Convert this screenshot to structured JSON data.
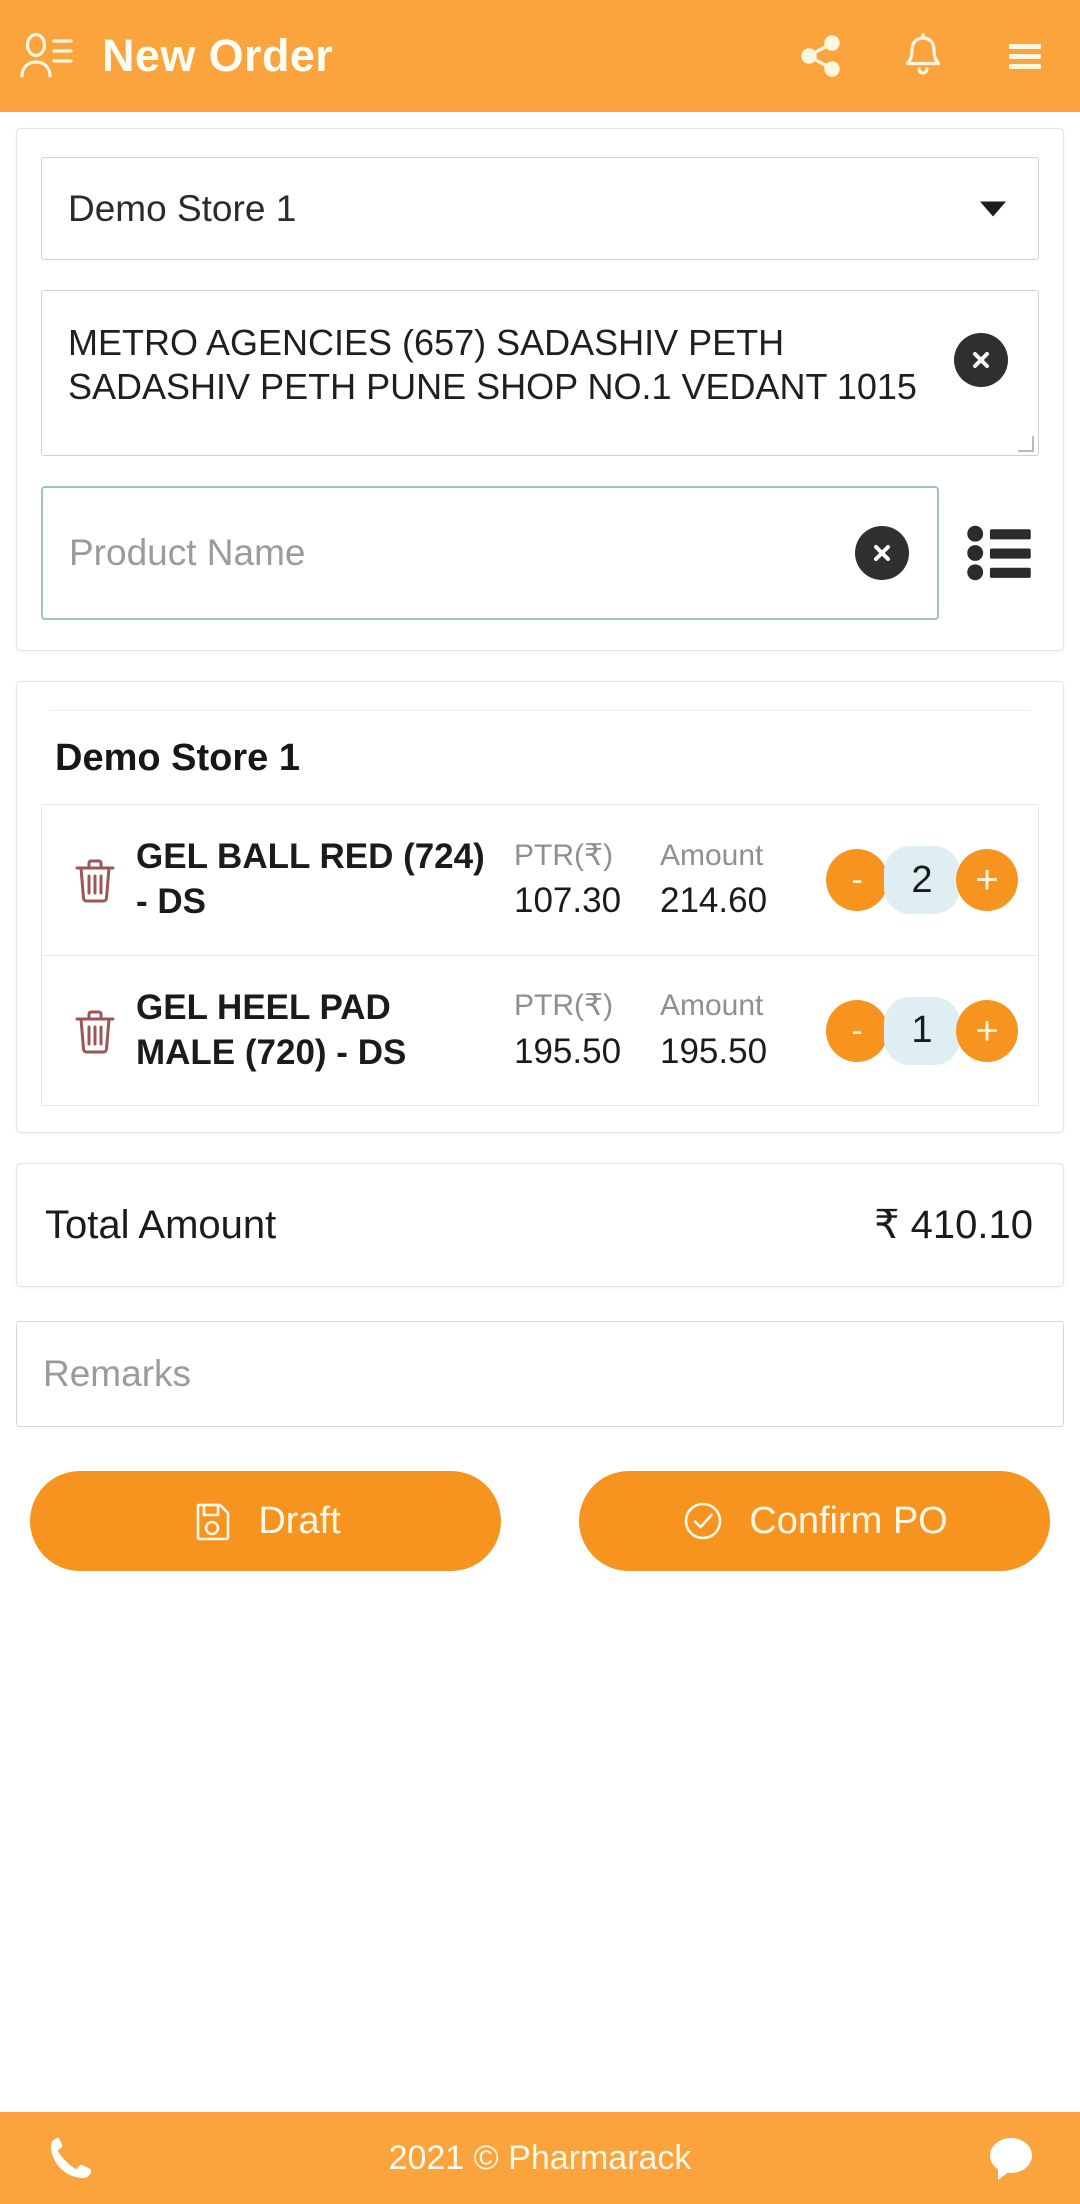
{
  "header": {
    "title": "New Order",
    "profile_icon": "user-list-icon",
    "actions": [
      {
        "icon": "share-icon",
        "name": "share-button"
      },
      {
        "icon": "bell-icon",
        "name": "notifications-button"
      },
      {
        "icon": "hamburger-menu-icon",
        "name": "menu-button"
      }
    ],
    "background": "#FBA33C"
  },
  "order_form": {
    "store_select": {
      "value": "Demo Store 1",
      "caret_icon": "chevron-down-icon"
    },
    "distributor": {
      "value": "METRO AGENCIES (657) SADASHIV PETH SADASHIV PETH PUNE SHOP NO.1 VEDANT 1015",
      "clear_icon": "clear-circle-icon"
    },
    "product_search": {
      "placeholder": "Product Name",
      "value": "",
      "clear_icon": "clear-circle-icon",
      "list_icon": "list-view-icon",
      "focus_border": "#9dc2cf"
    }
  },
  "cart": {
    "store_name": "Demo Store 1",
    "columns": {
      "ptr": "PTR(₹)",
      "amount": "Amount"
    },
    "items": [
      {
        "name": "GEL BALL RED (724) - DS",
        "ptr": "107.30",
        "amount": "214.60",
        "qty": "2",
        "delete_icon": "trash-icon",
        "minus_label": "-",
        "plus_label": "+"
      },
      {
        "name": "GEL HEEL PAD MALE (720) - DS",
        "ptr": "195.50",
        "amount": "195.50",
        "qty": "1",
        "delete_icon": "trash-icon",
        "minus_label": "-",
        "plus_label": "+"
      }
    ]
  },
  "total": {
    "label": "Total Amount",
    "value": "₹ 410.10"
  },
  "remarks": {
    "placeholder": "Remarks",
    "value": ""
  },
  "actions": {
    "draft": {
      "label": "Draft",
      "icon": "save-floppy-icon"
    },
    "confirm": {
      "label": "Confirm PO",
      "icon": "check-circle-icon"
    }
  },
  "footer": {
    "copyright": "2021 © Pharmarack",
    "phone_icon": "phone-icon",
    "chat_icon": "chat-bubble-icon",
    "background": "#FBA33C"
  },
  "colors": {
    "accent_orange": "#F79420",
    "header_orange": "#FBA33C",
    "qty_chip": "#DEEEF3",
    "trash_red": "#9E5555"
  }
}
